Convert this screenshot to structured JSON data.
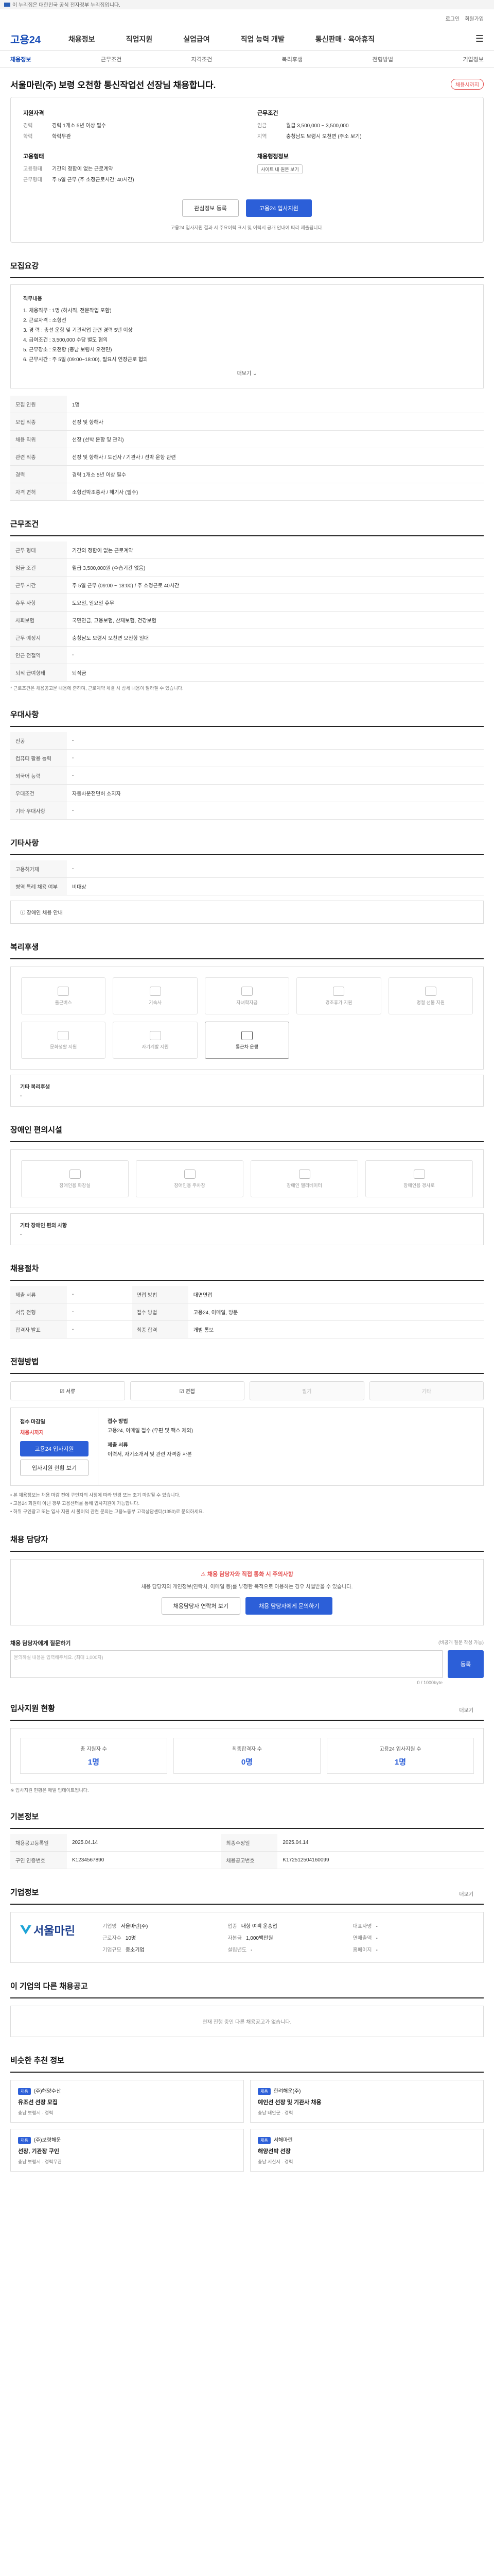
{
  "topbar": {
    "text": "이 누리집은 대한민국 공식 전자정부 누리집입니다."
  },
  "util": {
    "login": "로그인",
    "join": "회원가입"
  },
  "gnb": {
    "logo": "고용24",
    "menu": [
      "채용정보",
      "직업지원",
      "실업급여",
      "직업 능력 개발",
      "통신판매 · 육아휴직"
    ]
  },
  "subnav": [
    "채용정보",
    "근무조건",
    "자격조건",
    "복리후생",
    "전형방법",
    "기업정보"
  ],
  "job": {
    "title": "서울마린(주) 보령 오천항 통신작업선 선장님 채용합니다.",
    "badge": "채용시까지"
  },
  "summary": {
    "left_h": "지원자격",
    "career_k": "경력",
    "career_v": "경력 1개소 5년 이상 필수",
    "edu_k": "학력",
    "edu_v": "학력무관",
    "work_h": "고용형태",
    "emp_k": "고용형태",
    "emp_v": "기간의 정함이 없는 근로계약",
    "wage_k": "근무형태",
    "wage_v": "주 5일 근무 (주 소정근로시간: 40시간)",
    "right_h": "근무조건",
    "sal_k": "임금",
    "sal_v": "월급 3,500,000 ~ 3,500,000",
    "loc_k": "지역",
    "loc_v": "충청남도 보령시 오천면 (주소 보기)",
    "cert_h": "채용행정정보",
    "cert_pill": "사이트 내 원본 보기",
    "btn_like": "관심정보 등록",
    "btn_apply": "고용24 입사지원",
    "note": "고용24 입사지원 결과 시 주요이력 표시 및 이력서 공개 안내에 따라 제출됩니다."
  },
  "detail": {
    "title": "모집요강",
    "head": "직무내용",
    "lines": [
      "1. 채용직무 : 1명 (하사직, 전문작업 포함)",
      "2. 근로자격 : 소형선",
      "3. 경 력 : 총선 운항 및 기관작업 관련 경력 5년 이상",
      "4. 급여조건 : 3,500,000 수당 별도 협의",
      "5. 근무장소 : 오천항 (충남 보령시 오천면)",
      "6. 근무시간 : 주 5일 (09:00~18:00), 필요시 연장근로 협의"
    ],
    "more": "더보기"
  },
  "rows1": [
    {
      "k": "모집 인원",
      "v": "1명"
    },
    {
      "k": "모집 직종",
      "v": "선장 및 항해사"
    },
    {
      "k": "채용 직위",
      "v": "선장 (선박 운항 및 관리)"
    },
    {
      "k": "관련 직종",
      "v": "선장 및 항해사 / 도선사 / 기관사 / 선박 운항 관련"
    },
    {
      "k": "경력",
      "v": "경력 1개소 5년 이상 필수"
    },
    {
      "k": "자격 면허",
      "v": "소형선박조종사 / 해기사 (필수)"
    }
  ],
  "cond": {
    "title": "근무조건",
    "rows": [
      {
        "k": "근무 형태",
        "v": "기간의 정함이 없는 근로계약"
      },
      {
        "k": "임금 조건",
        "v": "월급 3,500,000원 (수습기간 없음)"
      },
      {
        "k": "근무 시간",
        "v": "주 5일 근무 (09:00 ~ 18:00) / 주 소정근로 40시간"
      },
      {
        "k": "휴무 사항",
        "v": "토요일, 일요일 휴무"
      },
      {
        "k": "사회보험",
        "v": "국민연금, 고용보험, 산재보험, 건강보험"
      },
      {
        "k": "근무 예정지",
        "v": "충청남도 보령시 오천면 오천항 일대"
      },
      {
        "k": "인근 전철역",
        "v": "-"
      },
      {
        "k": "퇴직 급여형태",
        "v": "퇴직금"
      }
    ],
    "note": "* 근로조건은 채용공고문 내용에 준하며, 근로계약 체결 시 상세 내용이 달라질 수 있습니다."
  },
  "qual": {
    "title": "우대사항",
    "rows": [
      {
        "k": "전공",
        "v": "-"
      },
      {
        "k": "컴퓨터 활용 능력",
        "v": "-"
      },
      {
        "k": "외국어 능력",
        "v": "-"
      },
      {
        "k": "우대조건",
        "v": "자동차운전면허 소지자"
      },
      {
        "k": "기타 우대사항",
        "v": "-"
      }
    ]
  },
  "etc": {
    "title": "기타사항",
    "rows": [
      {
        "k": "고용허가제",
        "v": "-"
      },
      {
        "k": "병역 특례 채용 여부",
        "v": "비대상"
      }
    ],
    "text": "장애인 채용 안내"
  },
  "welfare": {
    "title": "복리후생",
    "items": [
      "출근버스",
      "기숙사",
      "자녀학자금",
      "경조휴가 지원",
      "명절 선물 지원",
      "문화생활 지원",
      "자기계발 지원",
      "통근차 운행"
    ],
    "extra_h": "기타 복리후생",
    "extra_v": "-"
  },
  "disability": {
    "title": "장애인 편의시설",
    "items": [
      "장애인용 화장실",
      "장애인용 주차장",
      "장애인 엘리베이터",
      "장애인용 경사로"
    ],
    "extra_h": "기타 장애인 편의 사항",
    "extra_v": "-"
  },
  "recruit": {
    "title": "채용절차",
    "rows": [
      {
        "k": "제출 서류",
        "v": "-"
      },
      {
        "k": "면접 방법",
        "v": "대면면접"
      },
      {
        "k": "서류 전형",
        "v": "-"
      },
      {
        "k": "접수 방법",
        "v": "고용24, 이메일, 방문"
      },
      {
        "k": "합격자 발표",
        "v": "-"
      },
      {
        "k": "최종 합격",
        "v": "개별 통보"
      }
    ]
  },
  "apply": {
    "title": "전형방법",
    "methods": [
      "서류",
      "면접",
      "필기",
      "기타"
    ],
    "left_h": "접수 마감일",
    "left_v": "채용시까지",
    "btn1": "고용24 입사지원",
    "btn2": "입사지원 현황 보기",
    "right_h": "접수 방법",
    "right_v": "고용24, 이메일 접수 (우편 및 팩스 제외)",
    "right_h2": "제출 서류",
    "right_v2": "이력서, 자기소개서 및 관련 자격증 사본"
  },
  "notices": [
    "• 본 채용정보는 채용 마감 전에 구인자의 사정에 따라 변경 또는 조기 마감될 수 있습니다.",
    "• 고용24 회원이 아닌 경우 고용센터를 통해 입사지원이 가능합니다.",
    "• 허위 구인광고 또는 입사 지원 시 불이익 관련 문의는 고용노동부 고객상담센터(1350)로 문의하세요."
  ],
  "contact": {
    "title": "채용 담당자",
    "warn": "채용 담당자와 직접 통화 시 주의사항",
    "text": "채용 담당자의 개인정보(연락처, 이메일 등)를 부정한 목적으로 이용하는 경우 처벌받을 수 있습니다.",
    "btn1": "채용담당자 연락처 보기",
    "btn2": "채용 담당자에게 문의하기"
  },
  "inquiry": {
    "title": "채용 담당자에게 질문하기",
    "hint": "(비공개 질문 작성 가능)",
    "placeholder": "문의하실 내용을 입력해주세요. (최대 1,000자)",
    "count": "0 / 1000byte",
    "btn": "등록"
  },
  "stats": {
    "title": "입사지원 현황",
    "link": "더보기",
    "items": [
      {
        "k": "총 지원자 수",
        "v": "1명"
      },
      {
        "k": "최종합격자 수",
        "v": "0명"
      },
      {
        "k": "고용24 입사지원 수",
        "v": "1명"
      }
    ],
    "note": "※ 입사지원 현황은 매일 업데이트됩니다."
  },
  "info": {
    "title": "기본정보",
    "rows": [
      {
        "k": "채용공고등록일",
        "v": "2025.04.14",
        "k2": "최종수정일",
        "v2": "2025.04.14"
      },
      {
        "k": "구인 인증번호",
        "v": "K1234567890",
        "k2": "채용공고번호",
        "v2": "K172512504160099"
      }
    ]
  },
  "company": {
    "title": "기업정보",
    "link": "더보기",
    "name": "서울마린",
    "cols": [
      {
        "k": "기업명",
        "v": "서울마린(주)"
      },
      {
        "k": "업종",
        "v": "내항 여객 운송업"
      },
      {
        "k": "대표자명",
        "v": "-"
      },
      {
        "k": "근로자수",
        "v": "10명"
      },
      {
        "k": "자본금",
        "v": "1,000백만원"
      },
      {
        "k": "연매출액",
        "v": "-"
      },
      {
        "k": "기업규모",
        "v": "중소기업"
      },
      {
        "k": "설립년도",
        "v": "-"
      },
      {
        "k": "홈페이지",
        "v": "-"
      }
    ]
  },
  "same": {
    "title": "이 기업의 다른 채용공고",
    "empty": "현재 진행 중인 다른 채용공고가 없습니다."
  },
  "rec": {
    "title": "비슷한 추천 정보",
    "items": [
      {
        "tag": "채용",
        "co": "(주)해양수산",
        "t": "유조선 선장 모집",
        "m": "충남 보령시 · 경력"
      },
      {
        "tag": "채용",
        "co": "한려해운(주)",
        "t": "예인선 선장 및 기관사 채용",
        "m": "충남 태안군 · 경력"
      },
      {
        "tag": "채용",
        "co": "(주)보령해운",
        "t": "선장, 기관장 구인",
        "m": "충남 보령시 · 경력무관"
      },
      {
        "tag": "채용",
        "co": "서해마린",
        "t": "해양선박 선장",
        "m": "충남 서산시 · 경력"
      }
    ]
  }
}
